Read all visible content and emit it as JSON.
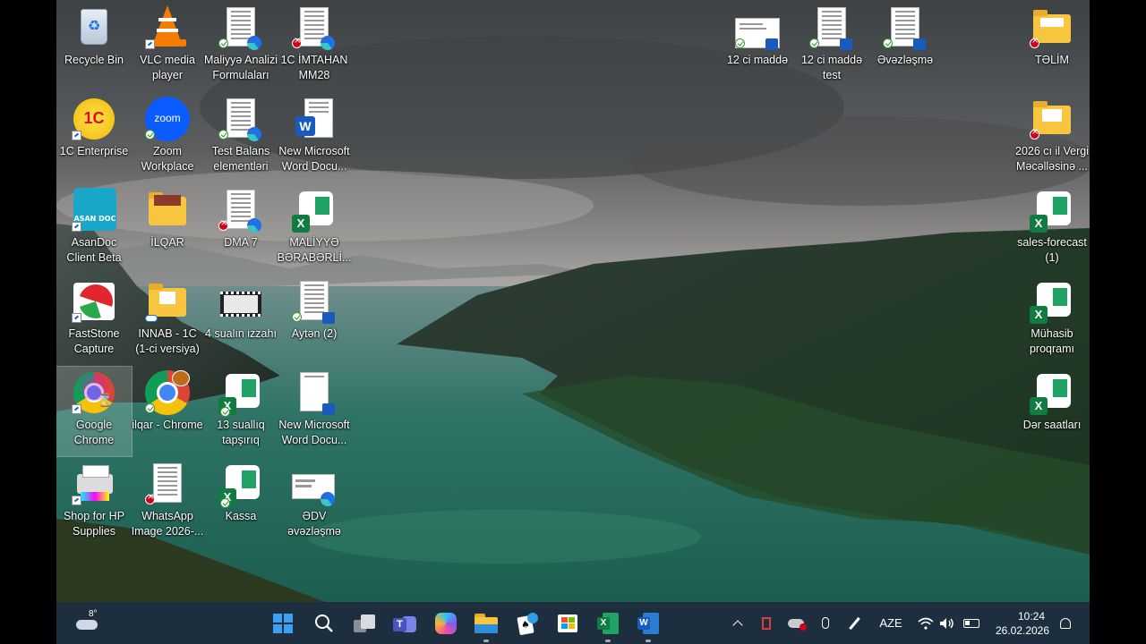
{
  "desktop": {
    "icons": [
      {
        "id": "recycle-bin",
        "label": "Recycle Bin"
      },
      {
        "id": "vlc",
        "label": "VLC media player"
      },
      {
        "id": "maliyye-analizi",
        "label": "Maliyyə Analizi Formulaları"
      },
      {
        "id": "1c-imtahan",
        "label": "1C İMTAHAN MM28"
      },
      {
        "id": "1c-enterprise",
        "label": "1C Enterprise"
      },
      {
        "id": "zoom",
        "label": "Zoom Workplace"
      },
      {
        "id": "test-balans",
        "label": "Test Balans elementləri"
      },
      {
        "id": "new-word-1",
        "label": "New Microsoft Word Docu..."
      },
      {
        "id": "asandoc",
        "label": "AsanDoc Client Beta"
      },
      {
        "id": "ilqar-folder",
        "label": "İLQAR"
      },
      {
        "id": "dma7",
        "label": "DMA 7"
      },
      {
        "id": "maliyye-beraberlik",
        "label": "MALİYYƏ BƏRABƏRLİ..."
      },
      {
        "id": "faststone",
        "label": "FastStone Capture"
      },
      {
        "id": "innab",
        "label": "INNAB - 1C (1-ci versiya)"
      },
      {
        "id": "4-sualin",
        "label": "4 sualın izzahı"
      },
      {
        "id": "aytan",
        "label": "Aytən (2)"
      },
      {
        "id": "google-chrome",
        "label": "Google Chrome"
      },
      {
        "id": "ilqar-chrome",
        "label": "ilqar - Chrome"
      },
      {
        "id": "13-suallig",
        "label": "13 suallıq tapşırıq"
      },
      {
        "id": "new-word-2",
        "label": "New Microsoft Word Docu..."
      },
      {
        "id": "shop-hp",
        "label": "Shop for HP Supplies"
      },
      {
        "id": "whatsapp-image",
        "label": "WhatsApp Image 2026-..."
      },
      {
        "id": "kassa",
        "label": "Kassa"
      },
      {
        "id": "edv",
        "label": "ƏDV əvəzləşmə"
      },
      {
        "id": "12-ci-madde",
        "label": "12 ci maddə"
      },
      {
        "id": "12-ci-madde-test",
        "label": "12 ci maddə test"
      },
      {
        "id": "evezlesme",
        "label": "Əvəzləşmə"
      },
      {
        "id": "telim",
        "label": "TƏLİM"
      },
      {
        "id": "2026-vergi",
        "label": "2026 cı il Vergi Məcəlləsinə ..."
      },
      {
        "id": "sales-forecast",
        "label": "sales-forecast (1)"
      },
      {
        "id": "muhasib",
        "label": "Mühasib proqramı"
      },
      {
        "id": "ders-saatlari",
        "label": "Dər saatları"
      }
    ]
  },
  "taskbar": {
    "weather_temp": "8°",
    "language": "AZE",
    "time": "10:24",
    "date": "26.02.2026",
    "icons": [
      "start-icon",
      "search-icon",
      "task-view-icon",
      "teams-icon",
      "copilot-icon",
      "file-explorer-icon",
      "solitaire-icon",
      "microsoft-store-icon",
      "excel-icon",
      "word-icon"
    ]
  },
  "colors": {
    "taskbar": "#1d2f3f",
    "accent": "#0a5fd6",
    "excel": "#107c41",
    "word": "#185abd"
  }
}
